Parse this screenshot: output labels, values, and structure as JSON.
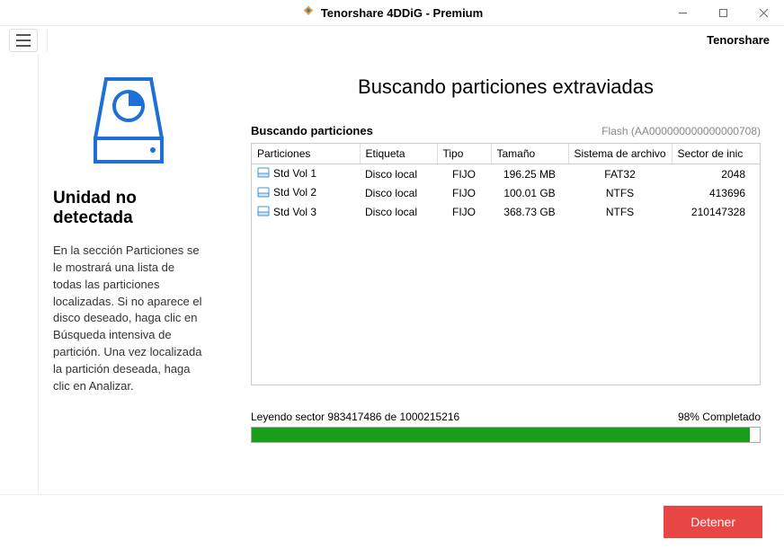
{
  "titlebar": {
    "title": "Tenorshare 4DDiG - Premium"
  },
  "toolbar": {
    "brand": "Tenorshare"
  },
  "sidebar": {
    "title": "Unidad no detectada",
    "description": "En la sección Particiones se le mostrará una lista de todas las particiones localizadas. Si no aparece el disco deseado, haga clic en Búsqueda intensiva de partición. Una vez localizada la partición deseada, haga clic en Analizar."
  },
  "main": {
    "heading": "Buscando particiones extraviadas",
    "list_label": "Buscando particiones",
    "device_id": "Flash (AA000000000000000708)",
    "columns": {
      "partition": "Particiones",
      "label": "Etiqueta",
      "type": "Tipo",
      "size": "Tamaño",
      "fs": "Sistema de archivo",
      "sector": "Sector de inic"
    },
    "rows": [
      {
        "name": "Std Vol 1",
        "label": "Disco local",
        "type": "FIJO",
        "size": "196.25 MB",
        "fs": "FAT32",
        "sector": "2048"
      },
      {
        "name": "Std Vol 2",
        "label": "Disco local",
        "type": "FIJO",
        "size": "100.01 GB",
        "fs": "NTFS",
        "sector": "413696"
      },
      {
        "name": "Std Vol 3",
        "label": "Disco local",
        "type": "FIJO",
        "size": "368.73 GB",
        "fs": "NTFS",
        "sector": "210147328"
      }
    ],
    "progress": {
      "status": "Leyendo sector 983417486 de 1000215216",
      "percent_text": "98% Completado",
      "percent": 98
    }
  },
  "footer": {
    "stop": "Detener"
  }
}
